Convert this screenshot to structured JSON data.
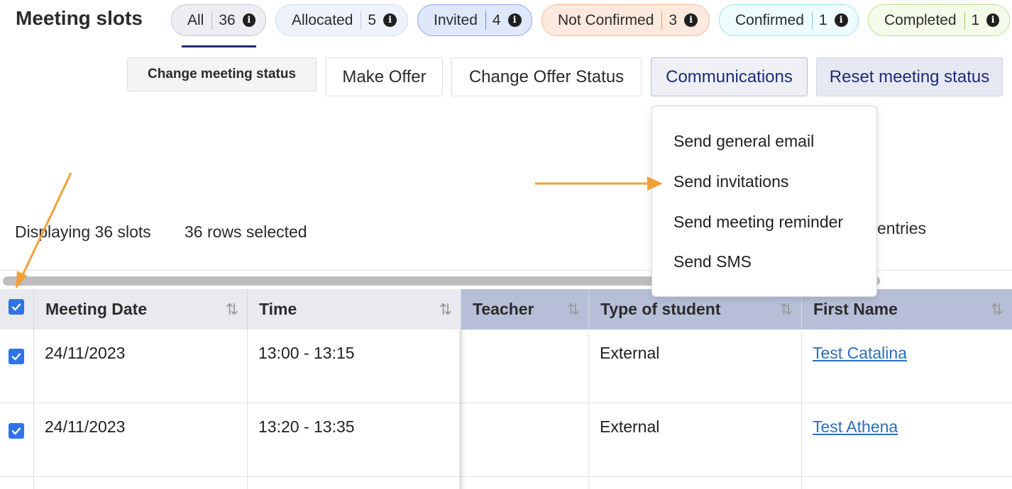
{
  "page": {
    "title": "Meeting slots"
  },
  "filters": [
    {
      "label": "All",
      "count": "36",
      "bg": "#eceef2",
      "border": "#c5c8cf",
      "sep": "#b8bbc2"
    },
    {
      "label": "Allocated",
      "count": "5",
      "bg": "#eef3fb",
      "border": "#cfdcf0",
      "sep": "#b8c9e6"
    },
    {
      "label": "Invited",
      "count": "4",
      "bg": "#dfe8fb",
      "border": "#8fa9e0",
      "sep": "#6d8bd1"
    },
    {
      "label": "Not Confirmed",
      "count": "3",
      "bg": "#fde9de",
      "border": "#f0b995",
      "sep": "#e89a6c"
    },
    {
      "label": "Confirmed",
      "count": "1",
      "bg": "#eefcfd",
      "border": "#9fe3ea",
      "sep": "#7cd3dc"
    },
    {
      "label": "Completed",
      "count": "1",
      "bg": "#f4fbe9",
      "border": "#b9e291",
      "sep": "#9ad264"
    }
  ],
  "info_glyph": "i",
  "toolbar": {
    "change_status": "Change meeting status",
    "make_offer": "Make Offer",
    "change_offer_status": "Change Offer Status",
    "communications": "Communications",
    "reset_status": "Reset meeting status"
  },
  "communications_menu": [
    "Send general email",
    "Send invitations",
    "Send meeting reminder",
    "Send SMS"
  ],
  "status": {
    "displaying": "Displaying 36 slots",
    "selected": "36 rows selected",
    "entries": "entries"
  },
  "table": {
    "columns": [
      "Meeting Date",
      "Time",
      "Teacher",
      "Type of student",
      "First Name"
    ],
    "sort_glyph": "⇅",
    "rows": [
      {
        "date": "24/11/2023",
        "time": "13:00 - 13:15",
        "teacher": "",
        "type": "External",
        "first_name": "Test Catalina"
      },
      {
        "date": "24/11/2023",
        "time": "13:20 - 13:35",
        "teacher": "",
        "type": "External",
        "first_name": "Test Athena"
      }
    ]
  },
  "colors": {
    "accent": "#1e2a78",
    "checkbox": "#2f73e6",
    "annotation_arrow": "#f0a03a",
    "link": "#2a6fc0"
  }
}
